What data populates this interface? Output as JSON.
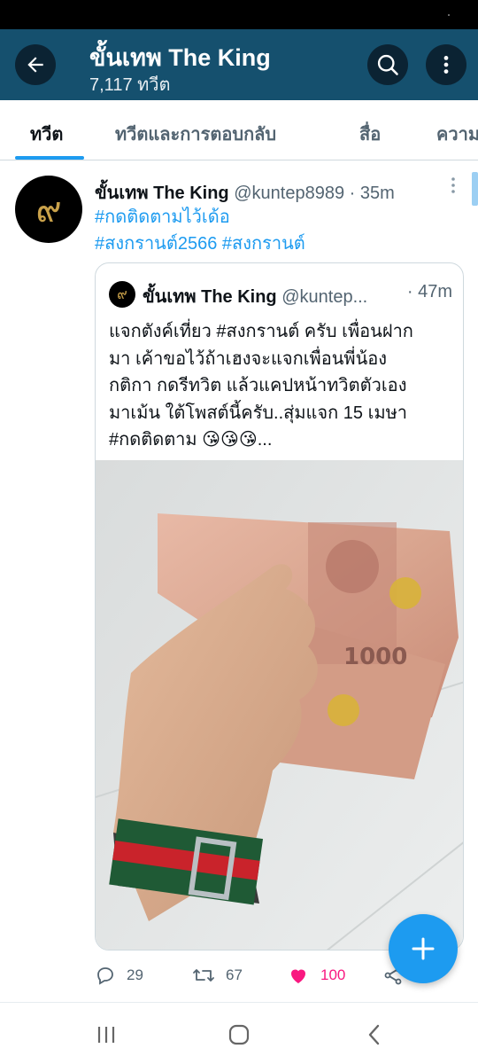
{
  "header": {
    "title": "ขั้นเทพ The King",
    "subtitle": "7,117 ทวีต",
    "icons": {
      "back": "arrow-left-icon",
      "search": "search-icon",
      "more": "more-vertical-icon"
    }
  },
  "tabs": [
    {
      "label": "ทวีต",
      "active": true
    },
    {
      "label": "ทวีตและการตอบกลับ",
      "active": false
    },
    {
      "label": "สื่อ",
      "active": false
    },
    {
      "label": "ความ",
      "active": false
    }
  ],
  "tweet": {
    "avatar_glyph": "๙",
    "name": "ขั้นเทพ The King",
    "handle": "@kuntep8989",
    "separator": "·",
    "time": "35m",
    "text_line1": "#กดติดตามไว้เด้อ",
    "text_line2": "#สงกรานต์2566 #สงกรานต์",
    "quote": {
      "name": "ขั้นเทพ The King",
      "handle": "@kuntep...",
      "time": "· 47m",
      "line1": "แจกตังค์เที่ยว #สงกรานต์ ครับ เพื่อนฝาก",
      "line2": "มา เค้าขอไว้ถ้าเฮงจะแจกเพื่อนพี่น้อง",
      "line3": "กติกา กดรีทวิต แล้วแคปหน้าทวิตตัวเอง",
      "line4": "มาเม้น ใต้โพสต์นี้ครับ..สุ่มแจก 15 เมษา",
      "line5": "#กดติดตาม 😘😘😘...",
      "banknote_value": "1000"
    },
    "actions": {
      "replies": "29",
      "retweets": "67",
      "likes": "100"
    }
  },
  "colors": {
    "header_bg": "#15506e",
    "accent": "#1d9bf0",
    "like": "#f91880"
  }
}
